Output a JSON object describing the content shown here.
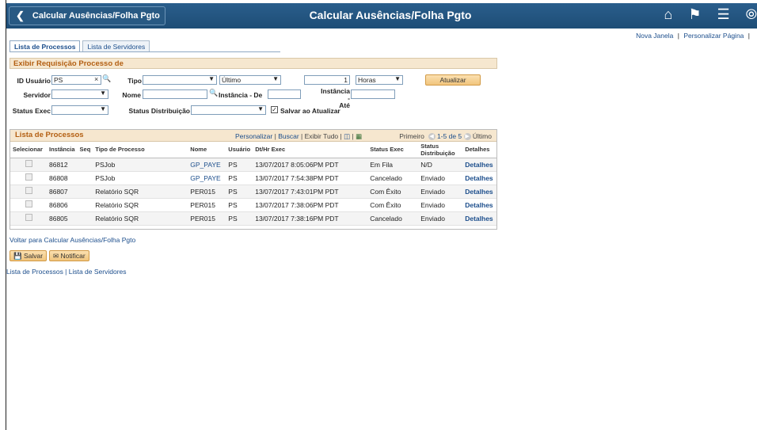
{
  "header": {
    "back_label": "Calcular Ausências/Folha Pgto",
    "title": "Calcular Ausências/Folha Pgto"
  },
  "top_links": {
    "new_window": "Nova Janela",
    "personalize": "Personalizar Página"
  },
  "tabs": [
    {
      "label": "Lista de Processos",
      "active": true
    },
    {
      "label": "Lista de Servidores",
      "active": false
    }
  ],
  "filter": {
    "section_title": "Exibir Requisição Processo de",
    "user_id_label": "ID Usuário",
    "user_id_value": "PS",
    "tipo_label": "Tipo",
    "tipo_value": "",
    "periodo_value": "Último",
    "quantity_value": "1",
    "unit_value": "Horas",
    "atualizar_label": "Atualizar",
    "servidor_label": "Servidor",
    "servidor_value": "",
    "nome_label": "Nome",
    "nome_value": "",
    "inst_de_label": "Instância - De",
    "inst_de_value": "",
    "inst_ate_label1": "Instância -",
    "inst_ate_label2": "Até",
    "inst_ate_value": "",
    "status_exec_label": "Status Exec",
    "status_exec_value": "",
    "status_dist_label": "Status Distribuição",
    "status_dist_value": "",
    "salvar_label": "Salvar ao Atualizar",
    "salvar_checked": true
  },
  "grid": {
    "title": "Lista de Processos",
    "tools": {
      "personalize": "Personalizar",
      "find": "Buscar",
      "view_all": "Exibir Tudo"
    },
    "nav": {
      "first": "Primeiro",
      "range": "1-5 de 5",
      "last": "Último"
    },
    "columns": [
      "Selecionar",
      "Instância",
      "Seq",
      "Tipo de Processo",
      "Nome",
      "Usuário",
      "Dt/Hr Exec",
      "Status Exec",
      "Status Distribuição",
      "Detalhes"
    ],
    "rows": [
      {
        "inst": "86812",
        "seq": "",
        "tipo": "PSJob",
        "nome": "GP_PAYE",
        "usuario": "PS",
        "dt": "13/07/2017  8:05:06PM PDT",
        "status": "Em Fila",
        "dist": "N/D",
        "det": "Detalhes"
      },
      {
        "inst": "86808",
        "seq": "",
        "tipo": "PSJob",
        "nome": "GP_PAYE",
        "usuario": "PS",
        "dt": "13/07/2017  7:54:38PM PDT",
        "status": "Cancelado",
        "dist": "Enviado",
        "det": "Detalhes"
      },
      {
        "inst": "86807",
        "seq": "",
        "tipo": "Relatório SQR",
        "nome": "PER015",
        "usuario": "PS",
        "dt": "13/07/2017  7:43:01PM PDT",
        "status": "Com Êxito",
        "dist": "Enviado",
        "det": "Detalhes"
      },
      {
        "inst": "86806",
        "seq": "",
        "tipo": "Relatório SQR",
        "nome": "PER015",
        "usuario": "PS",
        "dt": "13/07/2017  7:38:06PM PDT",
        "status": "Com Êxito",
        "dist": "Enviado",
        "det": "Detalhes"
      },
      {
        "inst": "86805",
        "seq": "",
        "tipo": "Relatório SQR",
        "nome": "PER015",
        "usuario": "PS",
        "dt": "13/07/2017  7:38:16PM PDT",
        "status": "Cancelado",
        "dist": "Enviado",
        "det": "Detalhes"
      }
    ]
  },
  "footer": {
    "back_link": "Voltar para Calcular Ausências/Folha Pgto",
    "save_label": "Salvar",
    "notify_label": "Notificar",
    "tab_links": "Lista de Processos | Lista de Servidores"
  }
}
